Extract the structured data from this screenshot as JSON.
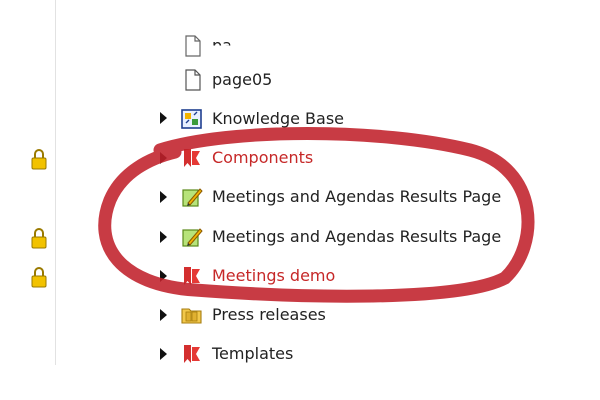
{
  "tree": {
    "items": [
      {
        "label": "pa",
        "icon": "page-icon"
      },
      {
        "label": "page05",
        "icon": "page-icon"
      },
      {
        "label": "Knowledge Base",
        "icon": "knowledge-base-icon"
      },
      {
        "label": "Components",
        "icon": "red-bookmark-icon"
      },
      {
        "label": "Meetings and Agendas Results Page",
        "icon": "pencil-page-icon"
      },
      {
        "label": "Meetings and Agendas Results Page",
        "icon": "pencil-page-icon"
      },
      {
        "label": "Meetings demo",
        "icon": "red-bookmark-icon"
      },
      {
        "label": "Press releases",
        "icon": "folder-icon"
      },
      {
        "label": "Templates",
        "icon": "red-bookmark-icon"
      }
    ]
  },
  "colors": {
    "accent_red": "#c62828",
    "annotation_red": "#c0202a",
    "lock_gold": "#e8b400"
  }
}
